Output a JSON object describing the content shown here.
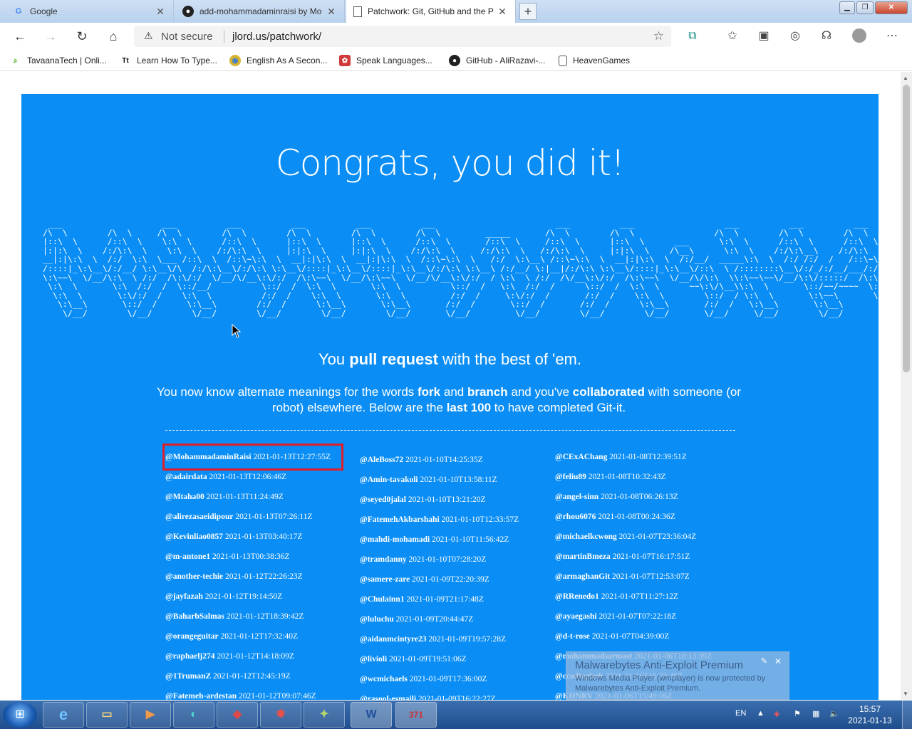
{
  "browser": {
    "tabs": [
      {
        "title": "Google",
        "icon": "google-icon",
        "active": false
      },
      {
        "title": "add-mohammadaminraisi by Mo",
        "icon": "github-icon",
        "active": false
      },
      {
        "title": "Patchwork: Git, GitHub and the P",
        "icon": "page-icon",
        "active": true
      }
    ],
    "new_tab": "+",
    "security_label": "Not secure",
    "url": "jlord.us/patchwork/",
    "favorites": [
      {
        "label": "TavaanaTech | Onli...",
        "icon": "tavaana-icon"
      },
      {
        "label": "Learn How To Type...",
        "icon": "typing-icon"
      },
      {
        "label": "English As A Secon...",
        "icon": "globe-icon"
      },
      {
        "label": "Speak Languages...",
        "icon": "speak-icon"
      },
      {
        "label": "GitHub - AliRazavi-...",
        "icon": "github-icon"
      },
      {
        "label": "HeavenGames",
        "icon": "page-icon"
      }
    ]
  },
  "page": {
    "headline": "Congrats, you did it!",
    "ascii_art": " ___                    ___          ___          ___          ___          ___                        ___          ___                  ___          ___          ___      \n/\\  \\        /\\  \\     /\\  \\        /\\  \\        /\\  \\        /\\  \\        /\\  \\         _____       /\\  \\        /\\  \\                /\\  \\        /\\  \\        /\\  \\     \n|::\\  \\      /::\\  \\    \\:\\  \\      /::\\  \\      |::\\  \\      |::\\  \\      /::\\  \\       /::\\  \\     /::\\  \\      |::\\  \\      ___      \\:\\  \\      /::\\  \\      /::\\  \\    \n|:|:\\  \\    /:/\\:\\  \\    \\:\\  \\    /:/\\:\\  \\     |:|:\\  \\     |:|:\\  \\    /:/\\:\\  \\     /:/\\:\\  \\   /:/\\:\\  \\     |:|:\\  \\    /\\__\\      \\:\\  \\    /:/\\:\\__\\    /:/\\:\\  \\   \n__|:|\\:\\  \\  /:/  \\:\\  \\___ /::\\  \\  /::\\~\\:\\  \\  __|:|\\:\\  \\  __|:|\\:\\  \\  /::\\~\\:\\  \\   /:/  \\:\\__\\ /::\\~\\:\\  \\  __|:|\\:\\  \\  /:/__/  _____\\:\\  \\  /:/ /:/  /   /::\\~\\:\\  \\  \n/::::|_\\:\\__\\/:/__/ \\:\\__\\/\\  /:/\\:\\__\\/:/\\:\\ \\:\\__\\/::::|_\\:\\__\\/::::|_\\:\\__\\/:/\\:\\ \\:\\__\\ /:/__/ \\:|__|/:/\\:\\ \\:\\__\\/::::|_\\:\\__\\/::\\  \\ /::::::::\\__\\/:/_/:/__/___/:/\\:\\ \\:\\__\\ \n\\:\\~~\\  \\/__/\\:\\  \\ /:/  /\\:\\/:/  \\/__/\\/__\\:\\/:/  /\\:\\~~\\  \\/__/\\:\\~~\\  \\/__/\\/__\\:\\/:/  / \\:\\  \\ /:/  /\\/__\\:\\/:/  /\\:\\~~\\  \\/__/\\/\\:\\  \\\\:\\~~\\~~\\/__/\\:\\/:::::/  /\\:\\~\\:\\ \\/__/ \n \\:\\  \\       \\:\\  /:/  /  \\::/__/          \\::/  /  \\:\\  \\       \\:\\  \\          \\::/  /   \\:\\  /:/  /      \\::/  /  \\:\\  \\      ~~\\:\\/\\__\\\\:\\  \\       \\::/~~/~~~~  \\:\\ \\:\\__\\   \n  \\:\\  \\       \\:\\/:/  /    \\:\\  \\          /:/  /    \\:\\  \\       \\:\\  \\         /:/  /     \\:\\/:/  /       /:/  /    \\:\\  \\        \\::/  / \\:\\  \\       \\:\\~~\\       \\:\\ \\/__/   \n   \\:\\__\\       \\::/  /      \\:\\__\\        /:/  /      \\:\\__\\       \\:\\__\\       /:/  /       \\::/  /       /:/  /      \\:\\__\\       /:/  /   \\:\\__\\       \\:\\__\\       \\:\\__\\     \n    \\/__/        \\/__/        \\/__/        \\/__/        \\/__/        \\/__/       \\/__/         \\/__/        \\/__/        \\/__/       \\/__/     \\/__/        \\/__/        \\/__/     ",
    "tagline": {
      "pre": "You ",
      "bold": "pull request",
      "post": " with the best of 'em."
    },
    "paragraph": {
      "p1": "You now know alternate meanings for the words ",
      "b1": "fork",
      "p2": " and ",
      "b2": "branch",
      "p3": " and you've ",
      "b3": "collaborated",
      "p4": " with someone (or robot) elsewhere. Below are the ",
      "b4": "last 100",
      "p5": " to have completed Git-it."
    },
    "columns": [
      [
        {
          "user": "@MohammadaminRaisi",
          "date": "2021-01-13T12:27:55Z"
        },
        {
          "user": "@adairdata",
          "date": "2021-01-13T12:06:46Z"
        },
        {
          "user": "@Mtaha00",
          "date": "2021-01-13T11:24:49Z"
        },
        {
          "user": "@alirezasaeidipour",
          "date": "2021-01-13T07:26:11Z"
        },
        {
          "user": "@Kevinliao0857",
          "date": "2021-01-13T03:40:17Z"
        },
        {
          "user": "@m-antone1",
          "date": "2021-01-13T00:38:36Z"
        },
        {
          "user": "@another-techie",
          "date": "2021-01-12T22:26:23Z"
        },
        {
          "user": "@jayfazah",
          "date": "2021-01-12T19:14:50Z"
        },
        {
          "user": "@BaharbSalmas",
          "date": "2021-01-12T18:39:42Z"
        },
        {
          "user": "@orangeguitar",
          "date": "2021-01-12T17:32:40Z"
        },
        {
          "user": "@raphaelj274",
          "date": "2021-01-12T14:18:09Z"
        },
        {
          "user": "@1TrumanZ",
          "date": "2021-01-12T12:45:19Z"
        },
        {
          "user": "@Fatemeh-ardestan",
          "date": "2021-01-12T09:07:46Z"
        }
      ],
      [
        {
          "user": "@AleBoss72",
          "date": "2021-01-10T14:25:35Z"
        },
        {
          "user": "@Amin-tavakoli",
          "date": "2021-01-10T13:58:11Z"
        },
        {
          "user": "@seyed0jalal",
          "date": "2021-01-10T13:21:20Z"
        },
        {
          "user": "@FatemehAkbarshahi",
          "date": "2021-01-10T12:33:57Z"
        },
        {
          "user": "@mahdi-mohamadi",
          "date": "2021-01-10T11:56:42Z"
        },
        {
          "user": "@tramdanny",
          "date": "2021-01-10T07:28:20Z"
        },
        {
          "user": "@samere-zare",
          "date": "2021-01-09T22:20:39Z"
        },
        {
          "user": "@Chulainn1",
          "date": "2021-01-09T21:17:48Z"
        },
        {
          "user": "@luluchu",
          "date": "2021-01-09T20:44:47Z"
        },
        {
          "user": "@aidanmcintyre23",
          "date": "2021-01-09T19:57:28Z"
        },
        {
          "user": "@livioli",
          "date": "2021-01-09T19:51:06Z"
        },
        {
          "user": "@wcmichaels",
          "date": "2021-01-09T17:36:00Z"
        },
        {
          "user": "@rasool-esmaili",
          "date": "2021-01-09T16:22:27Z"
        }
      ],
      [
        {
          "user": "@CExAChang",
          "date": "2021-01-08T12:39:51Z"
        },
        {
          "user": "@feliu89",
          "date": "2021-01-08T10:32:43Z"
        },
        {
          "user": "@angel-sinn",
          "date": "2021-01-08T06:26:13Z"
        },
        {
          "user": "@rhou6076",
          "date": "2021-01-08T00:24:36Z"
        },
        {
          "user": "@michaelkcwong",
          "date": "2021-01-07T23:36:04Z"
        },
        {
          "user": "@martinBmeza",
          "date": "2021-01-07T16:17:51Z"
        },
        {
          "user": "@armaghanGit",
          "date": "2021-01-07T12:53:07Z"
        },
        {
          "user": "@RRenedo1",
          "date": "2021-01-07T11:27:12Z"
        },
        {
          "user": "@ayaegashi",
          "date": "2021-01-07T07:22:18Z"
        },
        {
          "user": "@d-t-rose",
          "date": "2021-01-07T04:39:00Z"
        },
        {
          "user": "@mohammadsarmast",
          "date": "2021-01-06T18:13:39Z"
        },
        {
          "user": "@ccodinghub",
          "date": "2021-01-06T16:23:49Z"
        },
        {
          "user": "@KHNRV",
          "date": "2021-01-06T15:49:06Z"
        }
      ]
    ]
  },
  "toast": {
    "title": "Malwarebytes Anti-Exploit Premium",
    "message": "Windows Media Player (wmplayer) is now protected by Malwarebytes Anti-Exploit Premium."
  },
  "taskbar": {
    "language": "EN",
    "time": "15:57",
    "date": "2021-01-13",
    "word_label": "W",
    "calendar_label": "371"
  },
  "colors": {
    "panel": "#0a8ef6",
    "highlight": "#e01e2a"
  }
}
